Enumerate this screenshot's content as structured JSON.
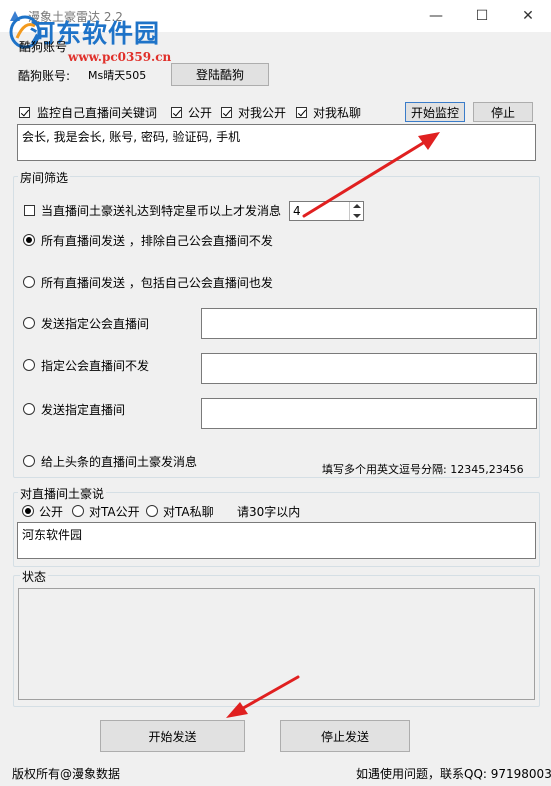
{
  "window": {
    "title": "漫象土豪雷达 2.2",
    "minimize": "—",
    "maximize": "☐",
    "close": "✕"
  },
  "watermark": {
    "name": "河东软件园",
    "url": "www.pc0359.cn"
  },
  "account": {
    "group_label": "酷狗账号",
    "field_label": "酷狗账号:",
    "username": "Ms晴天505",
    "login_button": "登陆酷狗"
  },
  "monitor": {
    "keyword_check_label": "监控自己直播间关键词",
    "keyword_checked": true,
    "public_label": "公开",
    "public_checked": true,
    "to_me_public_label": "对我公开",
    "to_me_public_checked": true,
    "to_me_private_label": "对我私聊",
    "to_me_private_checked": true,
    "start_button": "开始监控",
    "stop_button": "停止",
    "keywords": "会长, 我是会长, 账号, 密码, 验证码, 手机"
  },
  "room_filter": {
    "group_label": "房间筛选",
    "threshold_label": "当直播间土豪送礼达到特定星币以上才发消息",
    "threshold_checked": false,
    "threshold_value": "4",
    "options": [
      {
        "label": "所有直播间发送 ，排除自己公会直播间不发",
        "selected": true
      },
      {
        "label": "所有直播间发送 ，包括自己公会直播间也发",
        "selected": false
      },
      {
        "label": "发送指定公会直播间",
        "selected": false,
        "value": ""
      },
      {
        "label": "指定公会直播间不发",
        "selected": false,
        "value": ""
      },
      {
        "label": "发送指定直播间",
        "selected": false,
        "value": ""
      },
      {
        "label": "给上头条的直播间土豪发消息",
        "selected": false
      }
    ],
    "hint": "填写多个用英文逗号分隔: 12345,23456"
  },
  "say": {
    "group_label": "对直播间土豪说",
    "public_label": "公开",
    "public_selected": true,
    "ta_public_label": "对TA公开",
    "ta_public_selected": false,
    "ta_private_label": "对TA私聊",
    "ta_private_selected": false,
    "limit_note": "请30字以内",
    "message": "河东软件园"
  },
  "status": {
    "group_label": "状态",
    "content": ""
  },
  "actions": {
    "start_send": "开始发送",
    "stop_send": "停止发送"
  },
  "footer": {
    "copyright": "版权所有@漫象数据",
    "contact": "如遇使用问题，联系QQ: 97198003"
  },
  "colors": {
    "annotation_arrow": "#e02020",
    "watermark_blue": "#1e73c8",
    "watermark_red": "#e0302a",
    "window_bg": "#f0f0f0"
  }
}
